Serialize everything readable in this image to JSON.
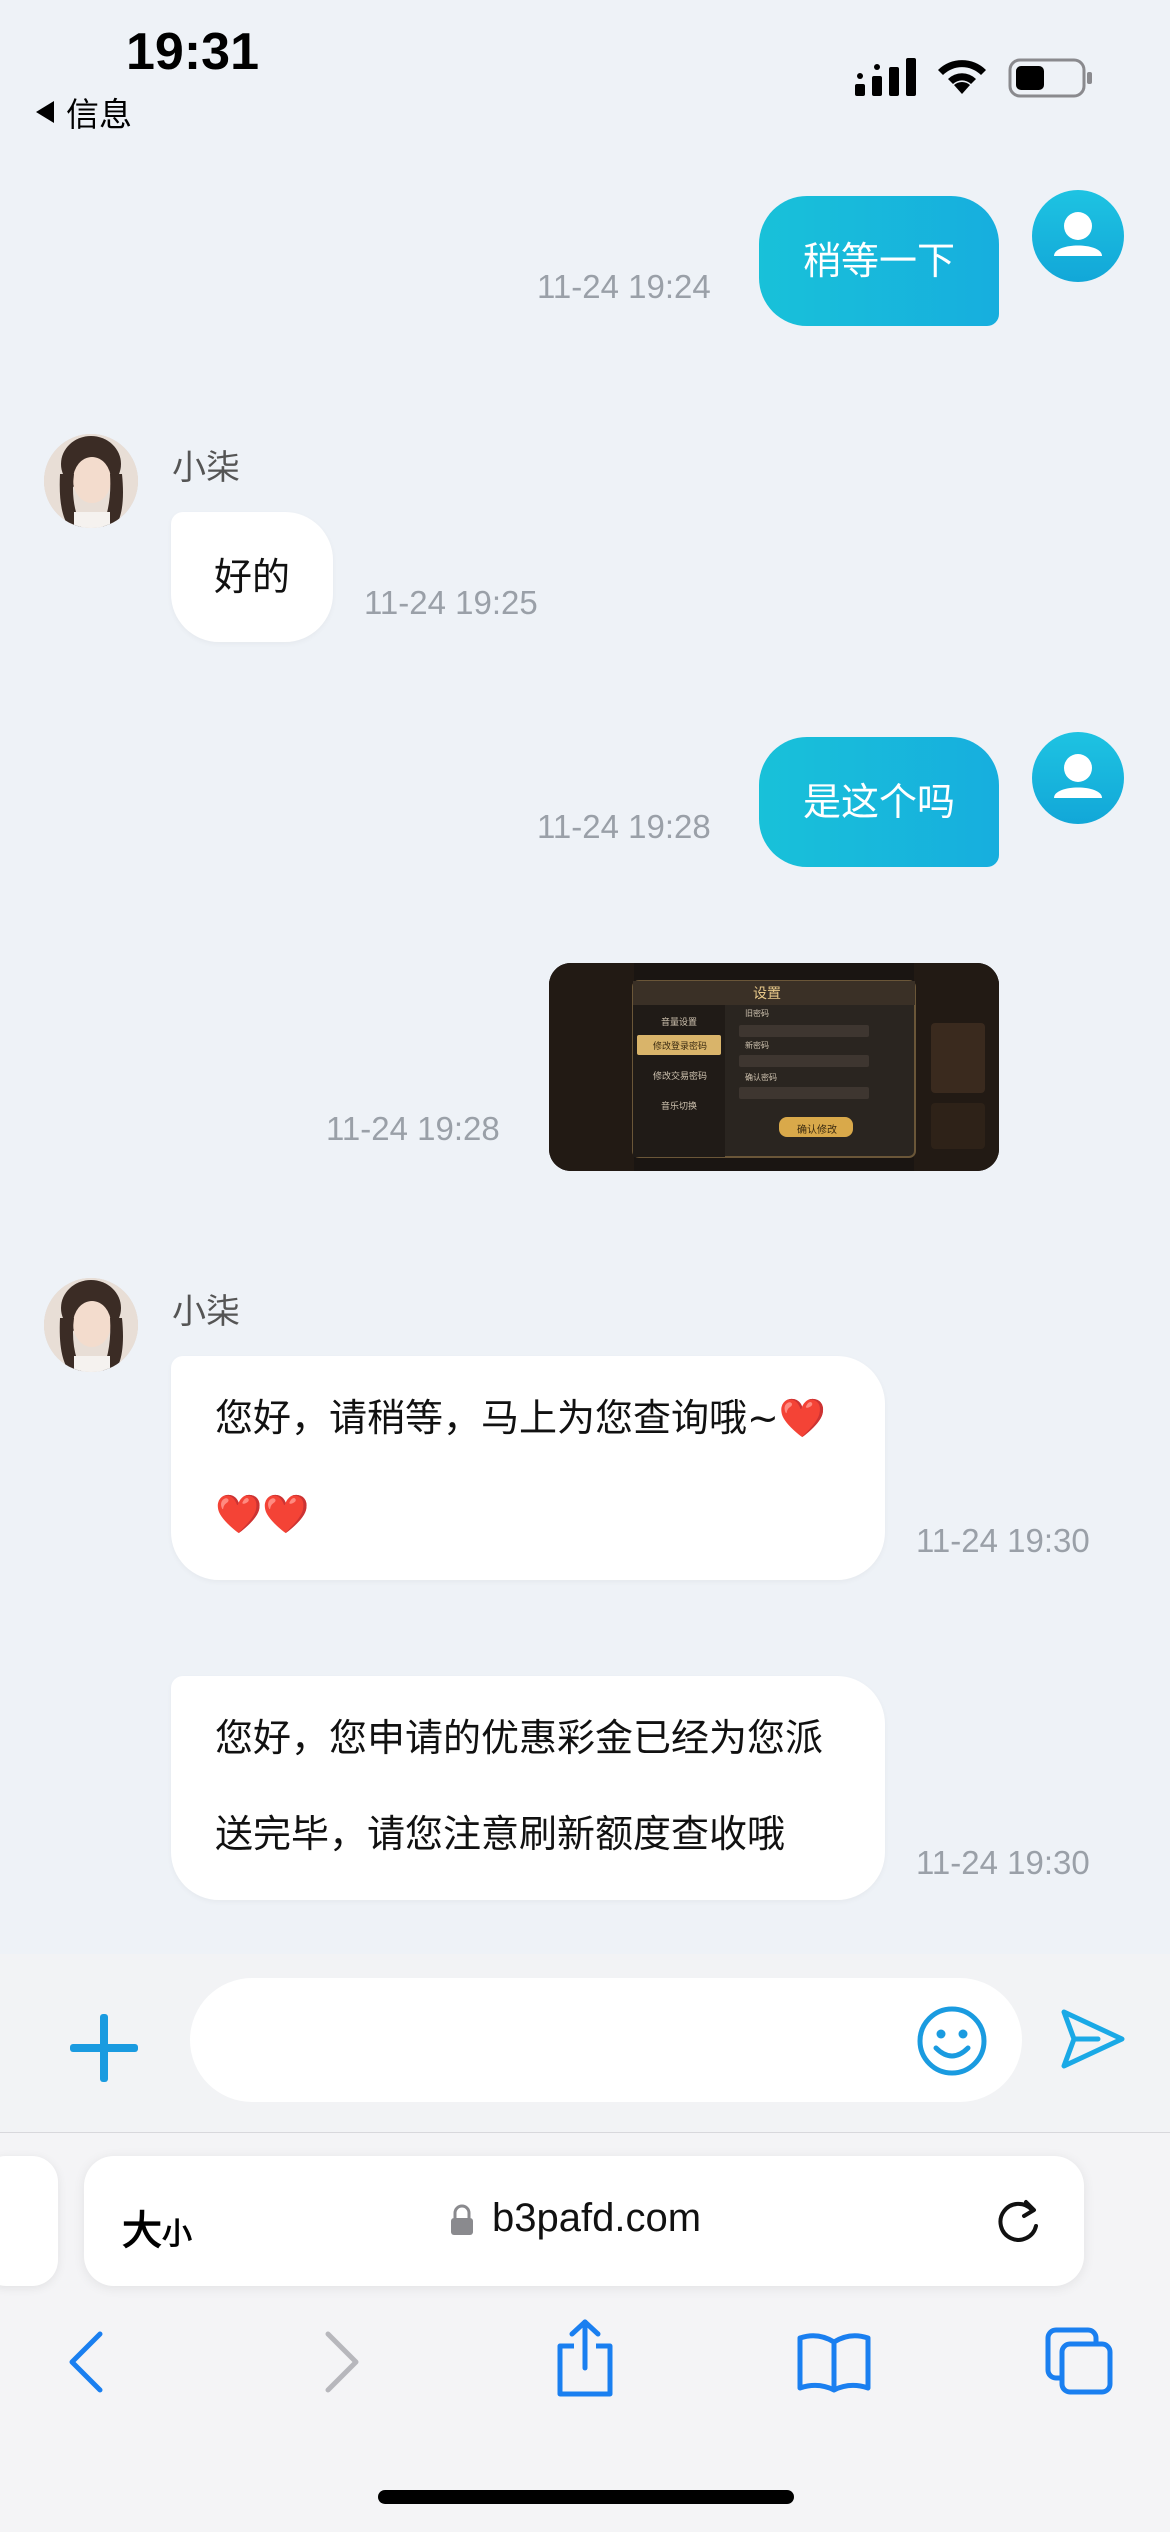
{
  "status_bar": {
    "time": "19:31",
    "back_label": "信息"
  },
  "agent": {
    "name": "小柒"
  },
  "messages": [
    {
      "side": "out",
      "text": "稍等一下",
      "time": "11-24 19:24"
    },
    {
      "side": "in",
      "text": "好的",
      "time": "11-24 19:25"
    },
    {
      "side": "out",
      "text": "是这个吗",
      "time": "11-24 19:28"
    },
    {
      "side": "out",
      "type": "image",
      "time": "11-24 19:28"
    },
    {
      "side": "in",
      "lines": [
        "您好，请稍等，马上为您查询哦~❤️",
        "❤️❤️"
      ],
      "time": "11-24 19:30"
    },
    {
      "side": "in",
      "lines": [
        "您好，您申请的优惠彩金已经为您派",
        "送完毕，请您注意刷新额度查收哦"
      ],
      "time": "11-24 19:30"
    }
  ],
  "screenshot": {
    "title": "设置",
    "menu": [
      "音量设置",
      "修改登录密码",
      "修改交易密码",
      "音乐切换"
    ],
    "fields": [
      "旧密码",
      "新密码",
      "确认密码"
    ],
    "confirm": "确认修改"
  },
  "input": {
    "value": "",
    "placeholder": ""
  },
  "browser": {
    "aa_big": "大",
    "aa_small": "小",
    "url": "b3pafd.com"
  },
  "colors": {
    "accent": "#17b8dc",
    "background": "#eef2f7",
    "send": "#1aa9e6"
  }
}
